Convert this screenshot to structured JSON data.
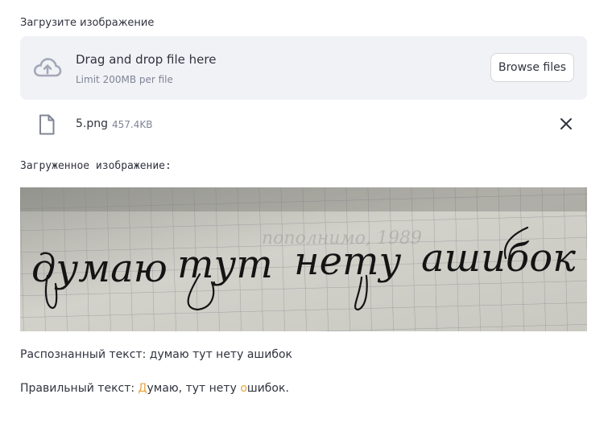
{
  "uploader": {
    "label": "Загрузите изображение",
    "dropzone_title": "Drag and drop file here",
    "dropzone_limit": "Limit 200MB per file",
    "browse_label": "Browse files",
    "icon": "cloud-upload-icon"
  },
  "uploaded_file": {
    "name": "5.png",
    "size": "457.4KB",
    "icon": "file-icon",
    "remove_icon": "close-icon"
  },
  "image_section": {
    "caption": "Загруженное изображение:",
    "handwriting_words": [
      "думаю",
      "тут",
      "нету",
      "ашибок"
    ]
  },
  "results": {
    "recognized_prefix": "Распознанный текст: ",
    "recognized_text": "думаю тут нету ашибок",
    "correct_prefix": "Правильный текст: ",
    "correct_parts": [
      "Д",
      "умаю, тут нету ",
      "о",
      "шибок."
    ]
  },
  "colors": {
    "highlight": "#e8a33d",
    "dropzone_bg": "#f0f2f6",
    "muted_text": "#808495"
  }
}
